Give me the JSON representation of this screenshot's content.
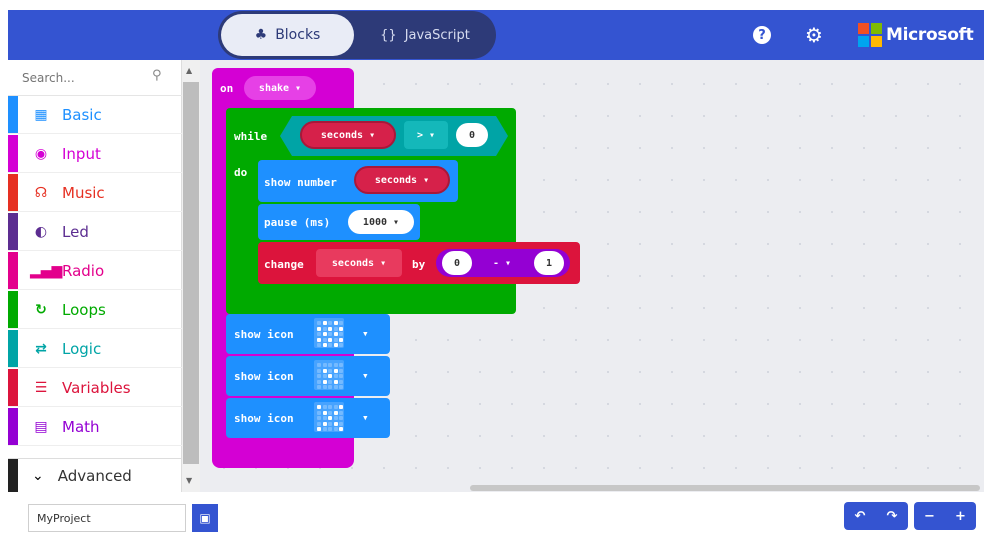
{
  "header": {
    "tab_blocks": "Blocks",
    "tab_javascript": "JavaScript",
    "help_glyph": "?",
    "brand": "Microsoft",
    "logo_colors": [
      "#f25022",
      "#7fba00",
      "#00a4ef",
      "#ffb900"
    ]
  },
  "sidebar": {
    "search_placeholder": "Search...",
    "categories": [
      {
        "label": "Basic",
        "color": "#1e90ff",
        "icon": "grid-icon"
      },
      {
        "label": "Input",
        "color": "#d400d4",
        "icon": "target-icon"
      },
      {
        "label": "Music",
        "color": "#e63022",
        "icon": "headphones-icon"
      },
      {
        "label": "Led",
        "color": "#5c2d91",
        "icon": "toggle-icon"
      },
      {
        "label": "Radio",
        "color": "#e3008c",
        "icon": "signal-icon"
      },
      {
        "label": "Loops",
        "color": "#00aa00",
        "icon": "refresh-icon"
      },
      {
        "label": "Logic",
        "color": "#00a4a6",
        "icon": "shuffle-icon"
      },
      {
        "label": "Variables",
        "color": "#dc143c",
        "icon": "list-icon"
      },
      {
        "label": "Math",
        "color": "#9400d3",
        "icon": "calculator-icon"
      }
    ],
    "advanced": "Advanced"
  },
  "blocks": {
    "on": "on",
    "event": "shake",
    "while": "while",
    "do": "do",
    "var": "seconds",
    "compare_op": ">",
    "compare_val": "0",
    "show_number": "show number",
    "pause": "pause (ms)",
    "pause_val": "1000",
    "change": "change",
    "by": "by",
    "math_a": "0",
    "math_op": "-",
    "math_b": "1",
    "show_icon": "show icon"
  },
  "colors": {
    "event": "#d400d4",
    "loops": "#00aa00",
    "basic": "#1e90ff",
    "variables": "#dc143c",
    "logic": "#00a4a6",
    "math": "#9400d3"
  },
  "footer": {
    "project_name": "MyProject",
    "undo": "↶",
    "redo": "↷",
    "zoom_out": "−",
    "zoom_in": "+"
  }
}
